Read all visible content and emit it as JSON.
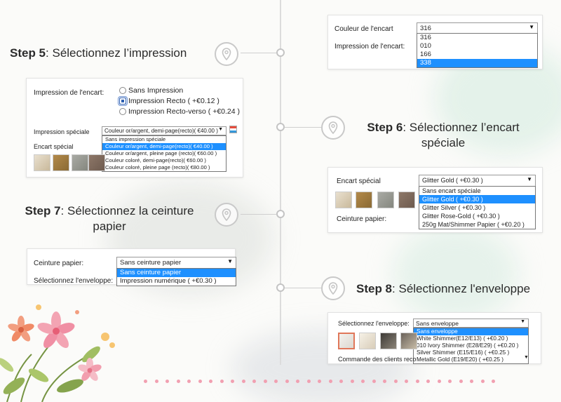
{
  "step5": {
    "label": "Step 5",
    "title": ": Sélectionnez l’impression"
  },
  "step6": {
    "label": "Step 6",
    "title": ": Sélectionnez l’encart",
    "title_line2": "spéciale"
  },
  "step7": {
    "label": "Step 7",
    "title": ": Sélectionnez la ceinture",
    "title_line2": "papier"
  },
  "step8": {
    "label": "Step 8",
    "title": ": Sélectionnez l'enveloppe"
  },
  "top_right": {
    "couleur_label": "Couleur de l'encart",
    "couleur_value": "316",
    "couleur_options": [
      "316",
      "010",
      "166",
      "338"
    ],
    "impression_label": "Impression de l'encart:"
  },
  "panel5": {
    "impression_label": "Impression de l'encart:",
    "radios": [
      {
        "label": "Sans Impression",
        "checked": false
      },
      {
        "label": "Impression Recto ( +€0.12 )",
        "checked": true
      },
      {
        "label": "Impression Recto-verso ( +€0.24 )",
        "checked": false
      }
    ],
    "speciale_label": "Impression spéciale",
    "speciale_value": "Couleur or/argent, demi-page(recto)( €40.00 )",
    "speciale_options": [
      "Sans impression spéciale",
      "Couleur or/argent, demi-page(recto)( €40.00 )",
      "Couleur or/argent, pleine page (recto)( €60.00 )",
      "Couleur coloré, demi-page(recto)( €60.00 )",
      "Couleur coloré, pleine page (recto)( €80.00 )"
    ],
    "encart_label": "Encart spécial"
  },
  "panel6": {
    "encart_label": "Encart spécial",
    "encart_value": "Glitter Gold ( +€0.30 )",
    "encart_options": [
      "Sans encart spéciale",
      "Glitter Gold ( +€0.30 )",
      "Glitter Silver ( +€0.30 )",
      "Glitter Rose-Gold ( +€0.30 )",
      "250g Mat/Shimmer Papier ( +€0.20 )"
    ],
    "ceinture_label": "Ceinture papier:"
  },
  "panel7": {
    "ceinture_label": "Ceinture papier:",
    "ceinture_value": "Sans ceinture papier",
    "ceinture_options": [
      "Sans ceinture papier",
      "Impression numérique ( +€0.30 )"
    ],
    "enveloppe_label": "Sélectionnez l'enveloppe:"
  },
  "panel8": {
    "enveloppe_label": "Sélectionnez l'enveloppe:",
    "enveloppe_value": "Sans enveloppe",
    "enveloppe_options": [
      "Sans enveloppe",
      "White Shimmer(E12/E13) ( +€0.20 )",
      "010 Ivory Shimmer (E28/E29) ( +€0.20 )",
      "Silver Shimmer (E15/E16) ( +€0.25 )",
      "Metallic Gold (E19/E20) ( +€0.25 )"
    ],
    "commande_label": "Commande des clients reco"
  },
  "colors": {
    "selected_option": "#1e90ff",
    "dots": "#f1a0b1",
    "timeline": "#dcdcdc"
  }
}
